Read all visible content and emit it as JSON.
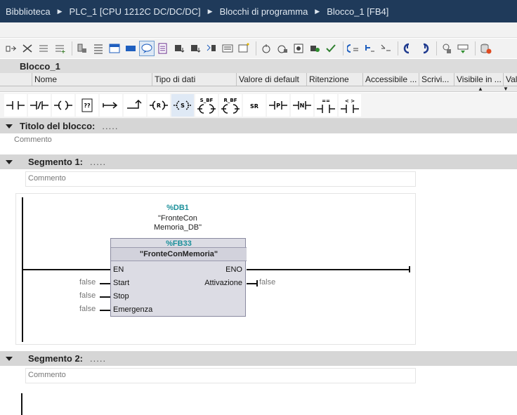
{
  "breadcrumb": [
    "Bibblioteca",
    "PLC_1 [CPU 1212C DC/DC/DC]",
    "Blocchi di programma",
    "Blocco_1 [FB4]"
  ],
  "toolbar_icons": [
    "insert-network-icon",
    "delete-network-icon",
    "insert-row-icon",
    "append-row-icon",
    "network-icon",
    "interface-icon",
    "favorites-icon",
    "comment-icon",
    "absolute-symbolic-icon",
    "tag-info-icon",
    "callstructure-icon",
    "network-comments-icon",
    "open-all-icon",
    "close-all-icon",
    "goto-icon",
    "monitor-icon",
    "breakpoint-icon",
    "step-icon",
    "next-error-icon",
    "prev-error-icon",
    "download-icon",
    "compare-icon",
    "online-icon",
    "snapshot-icon",
    "db-icon"
  ],
  "interface": {
    "block_name": "Blocco_1",
    "columns": [
      "Nome",
      "Tipo di dati",
      "Valore di default",
      "Ritenzione",
      "Accessibile ...",
      "Scrivi...",
      "Visibile in ...",
      "Val"
    ]
  },
  "lad_instructions": [
    "-| |-",
    "-|/|-",
    "-( )-",
    "??",
    "|->",
    "-->",
    "-(R)-",
    "-(S)-",
    "S_BF",
    "R_BF",
    "SR",
    "-|P|-",
    "-|N|-",
    "==",
    "< >"
  ],
  "block_title": {
    "label": "Titolo del blocco:",
    "dots": ".....",
    "comment": "Commento"
  },
  "segment1": {
    "label": "Segmento 1:",
    "dots": ".....",
    "comment": "Commento",
    "instance_db": "%DB1",
    "instance_name_line1": "\"FronteCon",
    "instance_name_line2": "Memoria_DB\"",
    "fb_number": "%FB33",
    "fb_name": "\"FronteConMemoria\"",
    "inputs": [
      "EN",
      "Start",
      "Stop",
      "Emergenza"
    ],
    "outputs": [
      "ENO",
      "Attivazione"
    ],
    "input_values": [
      "false",
      "false",
      "false"
    ],
    "output_value": "false"
  },
  "segment2": {
    "label": "Segmento 2:",
    "dots": ".....",
    "comment": "Commento"
  }
}
